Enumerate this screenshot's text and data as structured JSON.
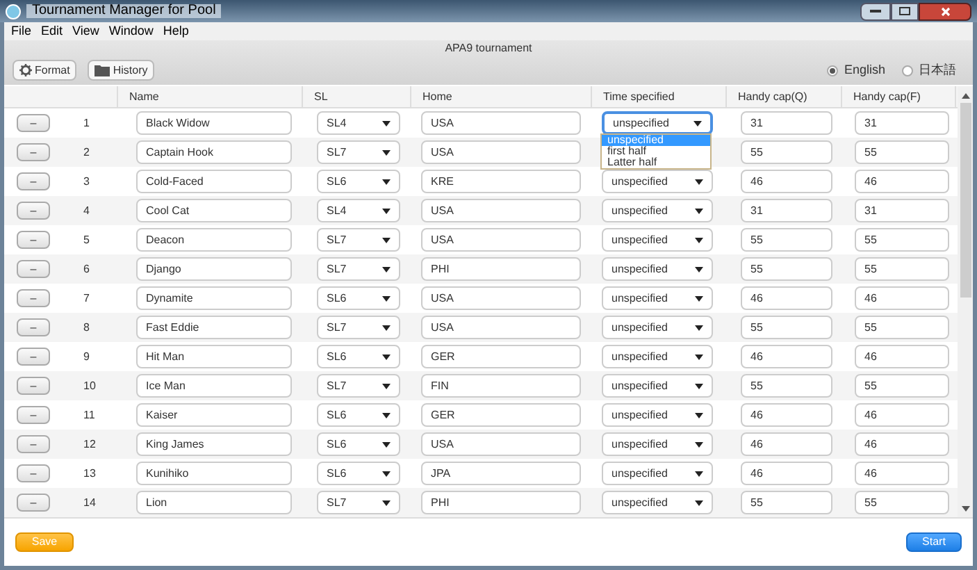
{
  "window": {
    "title": "Tournament Manager for Pool"
  },
  "menu": [
    "File",
    "Edit",
    "View",
    "Window",
    "Help"
  ],
  "header": {
    "title": "APA9 tournament"
  },
  "toolbar": [
    {
      "label": "Format",
      "kind": "gear"
    },
    {
      "label": "History",
      "kind": "folder"
    }
  ],
  "languages": [
    {
      "label": "English",
      "selected": true
    },
    {
      "label": "日本語",
      "selected": false
    }
  ],
  "table": {
    "columns": [
      "Name",
      "SL",
      "Home",
      "Time specified",
      "Handy cap(Q)",
      "Handy cap(F)"
    ],
    "rows": [
      {
        "remove": "–",
        "number": "1",
        "name": "Black Widow",
        "sl": "SL4",
        "home": "USA",
        "time": "unspecified",
        "q": "31",
        "f": "31",
        "focused": true
      },
      {
        "remove": "–",
        "number": "2",
        "name": "Captain Hook",
        "sl": "SL7",
        "home": "USA",
        "q": "55",
        "f": "55",
        "focused": false
      },
      {
        "remove": "–",
        "number": "3",
        "name": "Cold-Faced",
        "sl": "SL6",
        "home": "KRE",
        "time": "unspecified",
        "q": "46",
        "f": "46",
        "focused": false
      },
      {
        "remove": "–",
        "number": "4",
        "name": "Cool Cat",
        "sl": "SL4",
        "home": "USA",
        "time": "unspecified",
        "q": "31",
        "f": "31",
        "focused": false
      },
      {
        "remove": "–",
        "number": "5",
        "name": "Deacon",
        "sl": "SL7",
        "home": "USA",
        "time": "unspecified",
        "q": "55",
        "f": "55",
        "focused": false
      },
      {
        "remove": "–",
        "number": "6",
        "name": "Django",
        "sl": "SL7",
        "home": "PHI",
        "time": "unspecified",
        "q": "55",
        "f": "55",
        "focused": false
      },
      {
        "remove": "–",
        "number": "7",
        "name": "Dynamite",
        "sl": "SL6",
        "home": "USA",
        "time": "unspecified",
        "q": "46",
        "f": "46",
        "focused": false
      },
      {
        "remove": "–",
        "number": "8",
        "name": "Fast Eddie",
        "sl": "SL7",
        "home": "USA",
        "time": "unspecified",
        "q": "55",
        "f": "55",
        "focused": false
      },
      {
        "remove": "–",
        "number": "9",
        "name": "Hit Man",
        "sl": "SL6",
        "home": "GER",
        "time": "unspecified",
        "q": "46",
        "f": "46",
        "focused": false
      },
      {
        "remove": "–",
        "number": "10",
        "name": "Ice Man",
        "sl": "SL7",
        "home": "FIN",
        "time": "unspecified",
        "q": "55",
        "f": "55",
        "focused": false
      },
      {
        "remove": "–",
        "number": "11",
        "name": "Kaiser",
        "sl": "SL6",
        "home": "GER",
        "time": "unspecified",
        "q": "46",
        "f": "46",
        "focused": false
      },
      {
        "remove": "–",
        "number": "12",
        "name": "King James",
        "sl": "SL6",
        "home": "USA",
        "time": "unspecified",
        "q": "46",
        "f": "46",
        "focused": false
      },
      {
        "remove": "–",
        "number": "13",
        "name": "Kunihiko",
        "sl": "SL6",
        "home": "JPA",
        "time": "unspecified",
        "q": "46",
        "f": "46",
        "focused": false
      },
      {
        "remove": "–",
        "number": "14",
        "name": "Lion",
        "sl": "SL7",
        "home": "PHI",
        "time": "unspecified",
        "q": "55",
        "f": "55",
        "focused": false
      }
    ]
  },
  "dropdown": {
    "options": [
      {
        "label": "unspecified",
        "selected": true
      },
      {
        "label": "first half",
        "selected": false
      },
      {
        "label": "Latter half",
        "selected": false
      }
    ]
  },
  "footer": {
    "save": "Save",
    "start": "Start"
  }
}
